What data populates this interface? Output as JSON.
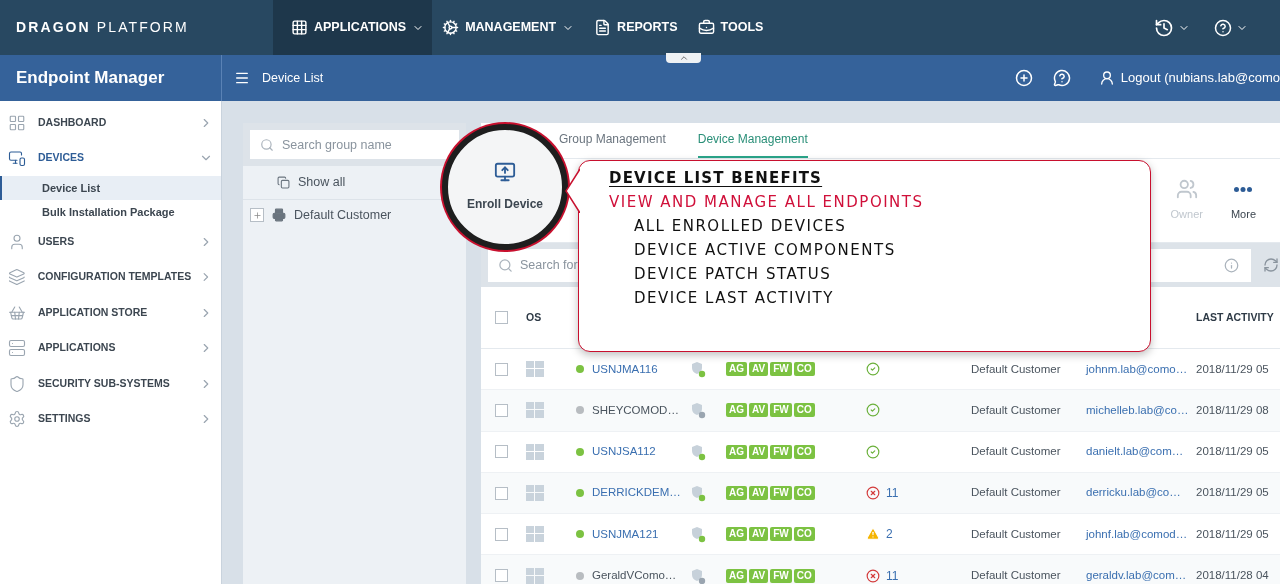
{
  "top_nav": {
    "logo_bold": "DRAGON",
    "logo_light": "PLATFORM",
    "menu": [
      {
        "label": "APPLICATIONS",
        "selected": true,
        "dropdown": true
      },
      {
        "label": "MANAGEMENT",
        "selected": false,
        "dropdown": true
      },
      {
        "label": "REPORTS",
        "selected": false,
        "dropdown": false
      },
      {
        "label": "TOOLS",
        "selected": false,
        "dropdown": false
      }
    ]
  },
  "header": {
    "title": "Endpoint Manager",
    "breadcrumb": "Device List",
    "user": "Logout (nubians.lab@como"
  },
  "sidebar": {
    "items": [
      {
        "label": "DASHBOARD",
        "expanded": false
      },
      {
        "label": "DEVICES",
        "expanded": true,
        "children": [
          {
            "label": "Device List",
            "selected": true
          },
          {
            "label": "Bulk Installation Package",
            "selected": false
          }
        ]
      },
      {
        "label": "USERS",
        "expanded": false
      },
      {
        "label": "CONFIGURATION TEMPLATES",
        "expanded": false
      },
      {
        "label": "APPLICATION STORE",
        "expanded": false
      },
      {
        "label": "APPLICATIONS",
        "expanded": false
      },
      {
        "label": "SECURITY SUB-SYSTEMS",
        "expanded": false
      },
      {
        "label": "SETTINGS",
        "expanded": false
      }
    ]
  },
  "groups": {
    "search_placeholder": "Search group name",
    "show_all": "Show all",
    "tree": [
      {
        "label": "Default Customer",
        "expanded": false
      }
    ]
  },
  "device_panel": {
    "tabs": [
      {
        "label": "Group Management",
        "selected": false
      },
      {
        "label": "Device Management",
        "selected": true
      }
    ],
    "enroll": {
      "label": "Enroll Device"
    },
    "toolbar": [
      {
        "label": "Owner",
        "disabled": true
      },
      {
        "label": "More",
        "disabled": false
      }
    ],
    "search_placeholder": "Search for",
    "select_all_checked": false,
    "columns": [
      "OS",
      "LAST ACTIVITY"
    ],
    "rows": [
      {
        "checked": false,
        "name": "USNJMA116",
        "online": true,
        "tags": [
          "AG",
          "AV",
          "FW",
          "CO"
        ],
        "patch": {
          "kind": "ok"
        },
        "customer": "Default Customer",
        "owner": "johnm.lab@como…",
        "last_activity": "2018/11/29 05"
      },
      {
        "checked": false,
        "name": "SHEYCOMOD…",
        "online": false,
        "tags": [
          "AG",
          "AV",
          "FW",
          "CO"
        ],
        "patch": {
          "kind": "ok"
        },
        "customer": "Default Customer",
        "owner": "michelleb.lab@co…",
        "last_activity": "2018/11/29 08"
      },
      {
        "checked": false,
        "name": "USNJSA112",
        "online": true,
        "tags": [
          "AG",
          "AV",
          "FW",
          "CO"
        ],
        "patch": {
          "kind": "ok"
        },
        "customer": "Default Customer",
        "owner": "danielt.lab@com…",
        "last_activity": "2018/11/29 05"
      },
      {
        "checked": false,
        "name": "DERRICKDEM…",
        "online": true,
        "tags": [
          "AG",
          "AV",
          "FW",
          "CO"
        ],
        "patch": {
          "kind": "error",
          "count": "11"
        },
        "customer": "Default Customer",
        "owner": "derricku.lab@co…",
        "last_activity": "2018/11/29 05"
      },
      {
        "checked": false,
        "name": "USNJMA121",
        "online": true,
        "tags": [
          "AG",
          "AV",
          "FW",
          "CO"
        ],
        "patch": {
          "kind": "warning",
          "count": "2"
        },
        "customer": "Default Customer",
        "owner": "johnf.lab@comod…",
        "last_activity": "2018/11/29 05"
      },
      {
        "checked": false,
        "name": "GeraldVComo…",
        "online": false,
        "tags": [
          "AG",
          "AV",
          "FW",
          "CO"
        ],
        "patch": {
          "kind": "error",
          "count": "11"
        },
        "customer": "Default Customer",
        "owner": "geraldv.lab@com…",
        "last_activity": "2018/11/28 04"
      }
    ]
  },
  "callout": {
    "title": "DEVICE LIST BENEFITS",
    "subtitle": "VIEW AND MANAGE ALL ENDPOINTS",
    "points": [
      "ALL ENROLLED DEVICES",
      "DEVICE ACTIVE COMPONENTS",
      "DEVICE PATCH STATUS",
      "DEVICE LAST ACTIVITY"
    ]
  }
}
